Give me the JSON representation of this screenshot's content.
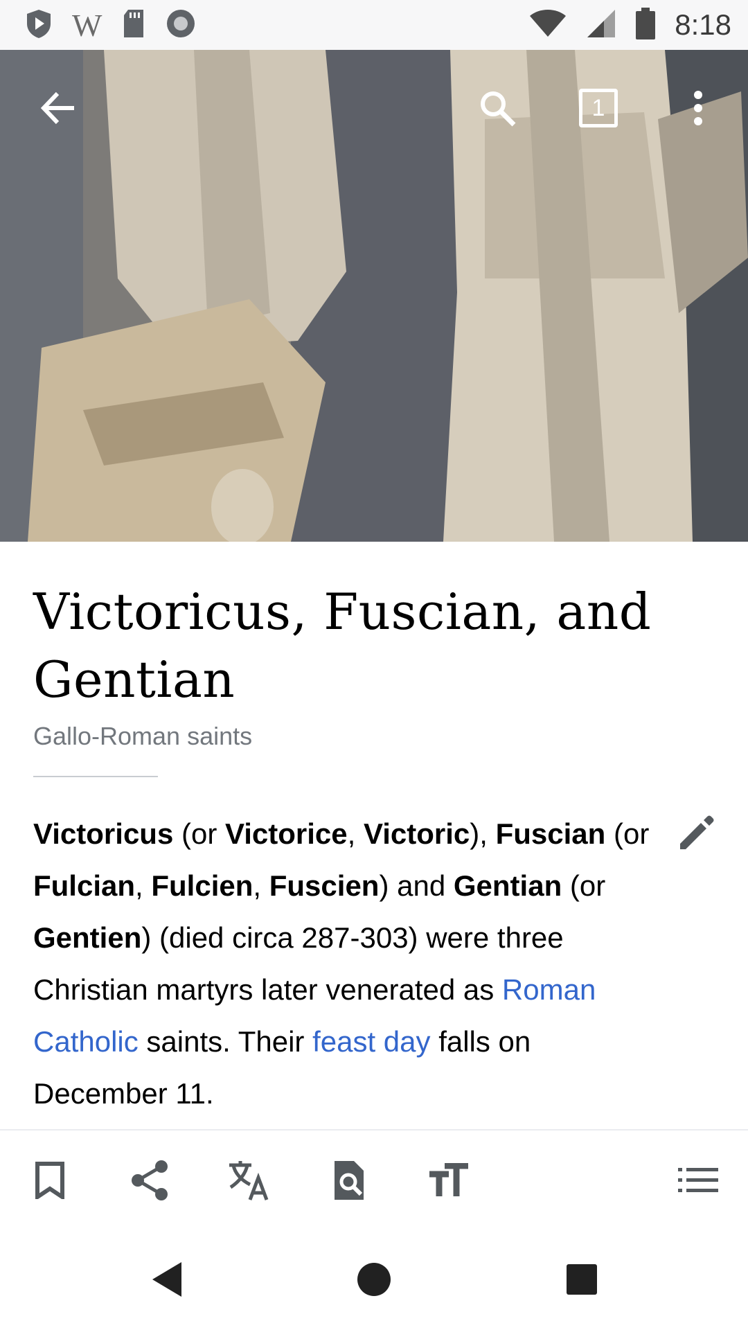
{
  "status_bar": {
    "time": "8:18",
    "left_icons": [
      "shield-play-icon",
      "wikipedia-w-icon",
      "sd-card-icon",
      "circle-record-icon"
    ],
    "w_glyph": "W",
    "right_icons": [
      "wifi-icon",
      "cellular-signal-icon",
      "battery-icon"
    ]
  },
  "top_bar": {
    "back_icon": "arrow-back-icon",
    "search_icon": "search-icon",
    "tabs_count": "1",
    "overflow_icon": "more-vert-icon"
  },
  "article": {
    "title": "Victoricus, Fuscian, and Gentian",
    "description": "Gallo-Roman saints",
    "lead": {
      "b1": "Victoricus",
      "t1": " (or ",
      "b2": "Victorice",
      "t2": ", ",
      "b3": "Victoric",
      "t3": "), ",
      "b4": "Fuscian",
      "t4": " (or ",
      "b5": "Fulcian",
      "t5": ", ",
      "b6": "Fulcien",
      "t6": ", ",
      "b7": "Fuscien",
      "t7": ") and ",
      "b8": "Gentian",
      "t8": " (or ",
      "b9": "Gentien",
      "t9": ") (died circa 287-303) were three Christian martyrs later venerated as ",
      "link1": "Roman Catholic",
      "t10": " saints. Their ",
      "link2": "feast day",
      "t11": " falls on December 11."
    },
    "edit_icon": "pencil-edit-icon"
  },
  "bottom_toolbar": {
    "items": [
      "bookmark-icon",
      "share-icon",
      "translate-icon",
      "find-in-page-icon",
      "text-size-icon",
      "table-of-contents-icon"
    ]
  },
  "nav_bar": {
    "items": [
      "nav-back-icon",
      "nav-home-icon",
      "nav-recents-icon"
    ]
  },
  "colors": {
    "link": "#3366cc",
    "description": "#72777d",
    "status_bar_bg": "#f7f7f8"
  }
}
